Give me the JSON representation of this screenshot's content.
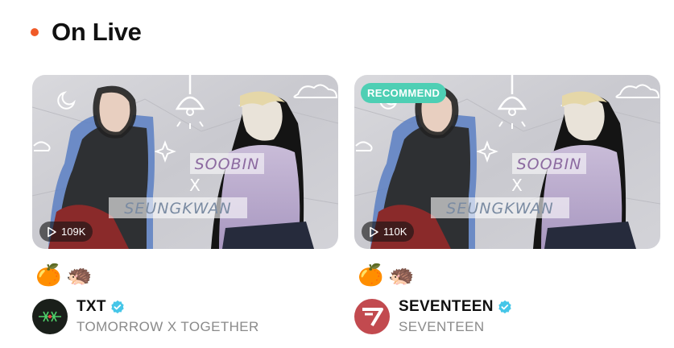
{
  "section": {
    "title": "On Live",
    "dot_color": "#f05a28"
  },
  "cards": [
    {
      "badge": null,
      "views": "109K",
      "thumb_text_top": "SOOBIN",
      "thumb_text_mid": "X",
      "thumb_text_bottom": "SEUNGKWAN",
      "emojis": [
        "🍊",
        "🦔"
      ],
      "artist": {
        "name": "TXT",
        "sub": "TOMORROW X TOGETHER",
        "avatar_icon": "txt-logo-icon",
        "verified": true
      }
    },
    {
      "badge": {
        "label": "RECOMMEND",
        "color": "#4ecfb4"
      },
      "views": "110K",
      "thumb_text_top": "SOOBIN",
      "thumb_text_mid": "X",
      "thumb_text_bottom": "SEUNGKWAN",
      "emojis": [
        "🍊",
        "🦔"
      ],
      "artist": {
        "name": "SEVENTEEN",
        "sub": "SEVENTEEN",
        "avatar_icon": "seventeen-logo-icon",
        "verified": true
      }
    }
  ],
  "colors": {
    "verified": "#45c6e8",
    "seventeen_brand": "#c24a4f",
    "txt_bg": "#1a1f1a"
  }
}
